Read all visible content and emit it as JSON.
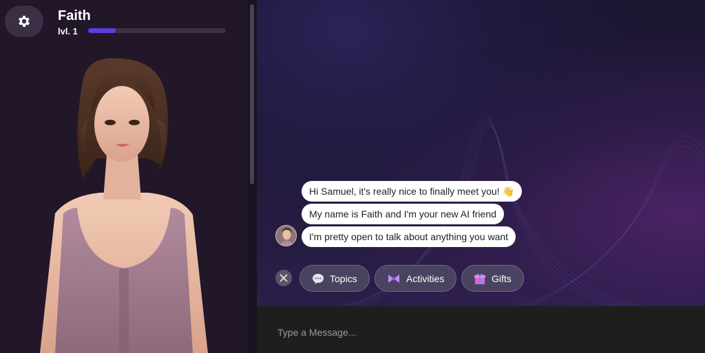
{
  "character": {
    "name": "Faith",
    "level_label": "lvl. 1",
    "level_progress": 0.2
  },
  "chat": {
    "messages": [
      "Hi Samuel, it's really nice to finally meet you! 👋",
      "My name is Faith and I'm your new AI friend",
      "I'm pretty open to talk about anything you want"
    ],
    "actions": [
      {
        "label": "Topics",
        "icon": "speech-bubble-icon"
      },
      {
        "label": "Activities",
        "icon": "bow-icon"
      },
      {
        "label": "Gifts",
        "icon": "gift-icon"
      }
    ]
  },
  "composer": {
    "placeholder": "Type a Message..."
  },
  "colors": {
    "accent": "#5b3fe0",
    "panel_bg": "#221629",
    "input_bg": "#1e1e1e"
  }
}
